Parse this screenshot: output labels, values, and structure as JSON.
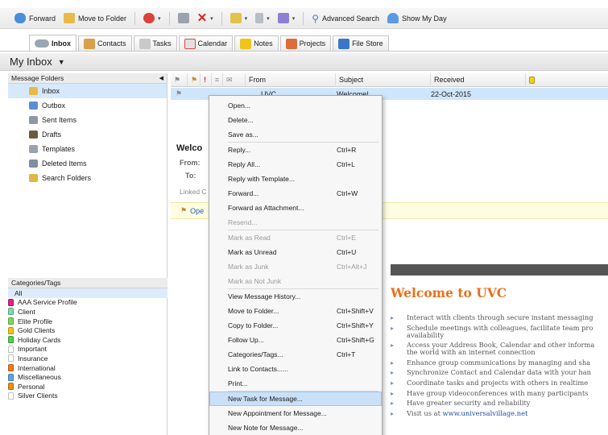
{
  "toolbar": {
    "forward": "Forward",
    "move_to_folder": "Move to Folder",
    "advanced_search": "Advanced Search",
    "show_my_day": "Show My Day"
  },
  "tabs": [
    "Inbox",
    "Contacts",
    "Tasks",
    "Calendar",
    "Notes",
    "Projects",
    "File Store"
  ],
  "view_title": "My Inbox",
  "folders": {
    "header": "Message Folders",
    "items": [
      "Inbox",
      "Outbox",
      "Sent Items",
      "Drafts",
      "Templates",
      "Deleted Items",
      "Search Folders"
    ]
  },
  "categories": {
    "header": "Categories/Tags",
    "items": [
      {
        "label": "All",
        "color": ""
      },
      {
        "label": "AAA Service Profile",
        "color": "#e0218a"
      },
      {
        "label": "Client",
        "color": "#7ad9b0"
      },
      {
        "label": "Elite Profile",
        "color": "#7fd65c"
      },
      {
        "label": "Gold Clients",
        "color": "#f0c419"
      },
      {
        "label": "Holiday Cards",
        "color": "#4bd34b"
      },
      {
        "label": "Important",
        "color": "#ffffff"
      },
      {
        "label": "Insurance",
        "color": "#ffffff"
      },
      {
        "label": "International",
        "color": "#f07c14"
      },
      {
        "label": "Miscellaneous",
        "color": "#5aa7e6"
      },
      {
        "label": "Personal",
        "color": "#f08c14"
      },
      {
        "label": "Silver Clients",
        "color": "#ffffff"
      }
    ]
  },
  "message_list": {
    "columns": [
      "From",
      "Subject",
      "Received"
    ],
    "row": {
      "from": "UVC",
      "subject": "Welcome!",
      "received": "22-Oct-2015"
    }
  },
  "preview": {
    "title": "Welco",
    "from_label": "From:",
    "to_label": "To:",
    "linked_label": "Linked C",
    "open_label": "Ope"
  },
  "context_menu": [
    {
      "label": "Open...",
      "shortcut": "",
      "disabled": false
    },
    {
      "label": "Delete...",
      "shortcut": "",
      "disabled": false
    },
    {
      "label": "Save as...",
      "shortcut": "",
      "disabled": false
    },
    {
      "sep": true
    },
    {
      "label": "Reply...",
      "shortcut": "Ctrl+R",
      "disabled": false
    },
    {
      "label": "Reply All...",
      "shortcut": "Ctrl+L",
      "disabled": false
    },
    {
      "label": "Reply with Template...",
      "shortcut": "",
      "disabled": false
    },
    {
      "label": "Forward...",
      "shortcut": "Ctrl+W",
      "disabled": false
    },
    {
      "label": "Forward as Attachment...",
      "shortcut": "",
      "disabled": false
    },
    {
      "label": "Resend...",
      "shortcut": "",
      "disabled": true
    },
    {
      "sep": true
    },
    {
      "label": "Mark as Read",
      "shortcut": "Ctrl+E",
      "disabled": true
    },
    {
      "label": "Mark as Unread",
      "shortcut": "Ctrl+U",
      "disabled": false
    },
    {
      "label": "Mark as Junk",
      "shortcut": "Ctrl+Alt+J",
      "disabled": true
    },
    {
      "label": "Mark as Not Junk",
      "shortcut": "",
      "disabled": true
    },
    {
      "sep": true
    },
    {
      "label": "View Message History...",
      "shortcut": "",
      "disabled": false
    },
    {
      "label": "Move to Folder...",
      "shortcut": "Ctrl+Shift+V",
      "disabled": false
    },
    {
      "label": "Copy to Folder...",
      "shortcut": "Ctrl+Shift+Y",
      "disabled": false
    },
    {
      "label": "Follow Up...",
      "shortcut": "Ctrl+Shift+G",
      "disabled": false
    },
    {
      "label": "Categories/Tags...",
      "shortcut": "Ctrl+T",
      "disabled": false
    },
    {
      "label": "Link to Contacts......",
      "shortcut": "",
      "disabled": false
    },
    {
      "label": "Print...",
      "shortcut": "",
      "disabled": false
    },
    {
      "sep": true
    },
    {
      "label": "New Task for Message...",
      "shortcut": "",
      "disabled": false,
      "highlighted": true
    },
    {
      "label": "New Appointment for Message...",
      "shortcut": "",
      "disabled": false
    },
    {
      "label": "New Note for Message...",
      "shortcut": "",
      "disabled": false
    }
  ],
  "email": {
    "heading": "Welcome to UVC",
    "bullets": [
      "Interact with clients through secure instant messaging",
      "Schedule meetings with colleagues, facilitate team pro",
      "availability",
      "Access your Address Book, Calendar and other informa",
      "the world with an internet connection",
      "Enhance group communications by managing and sha",
      "Synchronize Contact and Calendar data with your han",
      "Coordinate tasks and projects with others in realtime",
      "Have group videoconferences with many participants",
      "Have greater security and reliability",
      "Visit us at "
    ],
    "link": "www.universalvillage.net",
    "accent_color": "#e8701d"
  }
}
